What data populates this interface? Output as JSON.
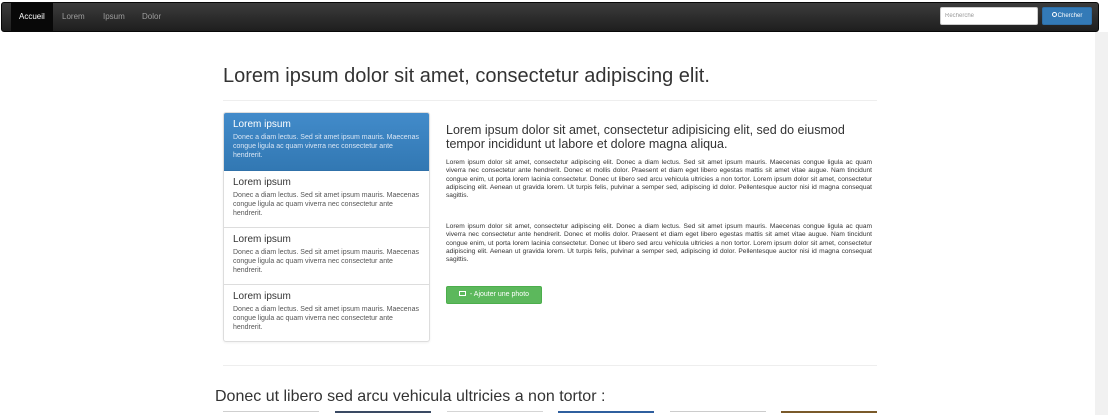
{
  "navbar": {
    "items": [
      {
        "label": "Accueil",
        "active": true
      },
      {
        "label": "Lorem",
        "active": false
      },
      {
        "label": "Ipsum",
        "active": false
      },
      {
        "label": "Dolor",
        "active": false
      }
    ],
    "search_placeholder": "Recherche",
    "search_button_label": "Chercher"
  },
  "page_title": "Lorem ipsum dolor sit amet, consectetur adipiscing elit.",
  "list_group": {
    "items": [
      {
        "title": "Lorem ipsum",
        "text": "Donec a diam lectus. Sed sit amet ipsum mauris. Maecenas congue ligula ac quam viverra nec consectetur ante hendrerit.",
        "active": true
      },
      {
        "title": "Lorem ipsum",
        "text": "Donec a diam lectus. Sed sit amet ipsum mauris. Maecenas congue ligula ac quam viverra nec consectetur ante hendrerit.",
        "active": false
      },
      {
        "title": "Lorem ipsum",
        "text": "Donec a diam lectus. Sed sit amet ipsum mauris. Maecenas congue ligula ac quam viverra nec consectetur ante hendrerit.",
        "active": false
      },
      {
        "title": "Lorem ipsum",
        "text": "Donec a diam lectus. Sed sit amet ipsum mauris. Maecenas congue ligula ac quam viverra nec consectetur ante hendrerit.",
        "active": false
      }
    ]
  },
  "article": {
    "title": "Lorem ipsum dolor sit amet, consectetur adipisicing elit, sed do eiusmod tempor incididunt ut labore et dolore magna aliqua.",
    "paragraphs": [
      "Lorem ipsum dolor sit amet, consectetur adipiscing elit. Donec a diam lectus. Sed sit amet ipsum mauris. Maecenas congue ligula ac quam viverra nec consectetur ante hendrerit. Donec et mollis dolor. Praesent et diam eget libero egestas mattis sit amet vitae augue. Nam tincidunt congue enim, ut porta lorem lacinia consectetur. Donec ut libero sed arcu vehicula ultricies a non tortor. Lorem ipsum dolor sit amet, consectetur adipiscing elit. Aenean ut gravida lorem. Ut turpis felis, pulvinar a semper sed, adipiscing id dolor. Pellentesque auctor nisi id magna consequat sagittis.",
      "Lorem ipsum dolor sit amet, consectetur adipiscing elit. Donec a diam lectus. Sed sit amet ipsum mauris. Maecenas congue ligula ac quam viverra nec consectetur ante hendrerit. Donec et mollis dolor. Praesent et diam eget libero egestas mattis sit amet vitae augue. Nam tincidunt congue enim, ut porta lorem lacinia consectetur. Donec ut libero sed arcu vehicula ultricies a non tortor. Lorem ipsum dolor sit amet, consectetur adipiscing elit. Aenean ut gravida lorem. Ut turpis felis, pulvinar a semper sed, adipiscing id dolor. Pellentesque auctor nisi id magna consequat sagittis."
    ],
    "photo_button_label": " - Ajouter une photo"
  },
  "section_title": "Donec ut libero sed arcu vehicula ultricies a non tortor :",
  "colors": {
    "navbar": "#222222",
    "primary": "#337ab7",
    "list_active": "#428bca",
    "success": "#5cb85c"
  }
}
